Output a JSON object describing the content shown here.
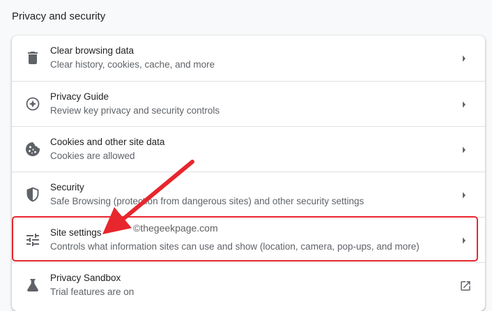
{
  "section": {
    "title": "Privacy and security"
  },
  "rows": [
    {
      "icon": "trash-icon",
      "title": "Clear browsing data",
      "subtitle": "Clear history, cookies, cache, and more"
    },
    {
      "icon": "privacy-guide-icon",
      "title": "Privacy Guide",
      "subtitle": "Review key privacy and security controls"
    },
    {
      "icon": "cookie-icon",
      "title": "Cookies and other site data",
      "subtitle": "Cookies are allowed"
    },
    {
      "icon": "shield-icon",
      "title": "Security",
      "subtitle": "Safe Browsing (protection from dangerous sites) and other security settings"
    },
    {
      "icon": "tune-sliders-icon",
      "title": "Site settings",
      "subtitle": "Controls what information sites can use and show (location, camera, pop-ups, and more)"
    },
    {
      "icon": "flask-icon",
      "title": "Privacy Sandbox",
      "subtitle": "Trial features are on"
    }
  ],
  "annotation": {
    "watermark": "©thegeekpage.com",
    "highlight_color": "#e8262d",
    "arrow_color": "#e8262d"
  },
  "colors": {
    "page_bg": "#f8f9fa",
    "card_bg": "#ffffff",
    "icon": "#5f6368",
    "title_text": "#202124",
    "subtitle_text": "#5f6368"
  }
}
